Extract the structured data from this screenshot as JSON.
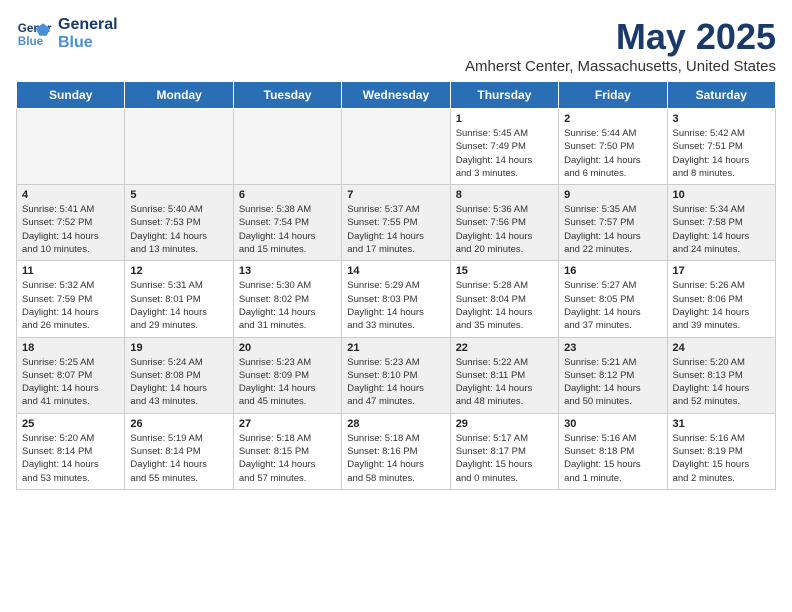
{
  "logo": {
    "line1": "General",
    "line2": "Blue"
  },
  "title": "May 2025",
  "subtitle": "Amherst Center, Massachusetts, United States",
  "headers": [
    "Sunday",
    "Monday",
    "Tuesday",
    "Wednesday",
    "Thursday",
    "Friday",
    "Saturday"
  ],
  "weeks": [
    [
      {
        "date": "",
        "text": "",
        "empty": true
      },
      {
        "date": "",
        "text": "",
        "empty": true
      },
      {
        "date": "",
        "text": "",
        "empty": true
      },
      {
        "date": "",
        "text": "",
        "empty": true
      },
      {
        "date": "1",
        "text": "Sunrise: 5:45 AM\nSunset: 7:49 PM\nDaylight: 14 hours\nand 3 minutes."
      },
      {
        "date": "2",
        "text": "Sunrise: 5:44 AM\nSunset: 7:50 PM\nDaylight: 14 hours\nand 6 minutes."
      },
      {
        "date": "3",
        "text": "Sunrise: 5:42 AM\nSunset: 7:51 PM\nDaylight: 14 hours\nand 8 minutes."
      }
    ],
    [
      {
        "date": "4",
        "text": "Sunrise: 5:41 AM\nSunset: 7:52 PM\nDaylight: 14 hours\nand 10 minutes.",
        "shaded": true
      },
      {
        "date": "5",
        "text": "Sunrise: 5:40 AM\nSunset: 7:53 PM\nDaylight: 14 hours\nand 13 minutes.",
        "shaded": true
      },
      {
        "date": "6",
        "text": "Sunrise: 5:38 AM\nSunset: 7:54 PM\nDaylight: 14 hours\nand 15 minutes.",
        "shaded": true
      },
      {
        "date": "7",
        "text": "Sunrise: 5:37 AM\nSunset: 7:55 PM\nDaylight: 14 hours\nand 17 minutes.",
        "shaded": true
      },
      {
        "date": "8",
        "text": "Sunrise: 5:36 AM\nSunset: 7:56 PM\nDaylight: 14 hours\nand 20 minutes.",
        "shaded": true
      },
      {
        "date": "9",
        "text": "Sunrise: 5:35 AM\nSunset: 7:57 PM\nDaylight: 14 hours\nand 22 minutes.",
        "shaded": true
      },
      {
        "date": "10",
        "text": "Sunrise: 5:34 AM\nSunset: 7:58 PM\nDaylight: 14 hours\nand 24 minutes.",
        "shaded": true
      }
    ],
    [
      {
        "date": "11",
        "text": "Sunrise: 5:32 AM\nSunset: 7:59 PM\nDaylight: 14 hours\nand 26 minutes."
      },
      {
        "date": "12",
        "text": "Sunrise: 5:31 AM\nSunset: 8:01 PM\nDaylight: 14 hours\nand 29 minutes."
      },
      {
        "date": "13",
        "text": "Sunrise: 5:30 AM\nSunset: 8:02 PM\nDaylight: 14 hours\nand 31 minutes."
      },
      {
        "date": "14",
        "text": "Sunrise: 5:29 AM\nSunset: 8:03 PM\nDaylight: 14 hours\nand 33 minutes."
      },
      {
        "date": "15",
        "text": "Sunrise: 5:28 AM\nSunset: 8:04 PM\nDaylight: 14 hours\nand 35 minutes."
      },
      {
        "date": "16",
        "text": "Sunrise: 5:27 AM\nSunset: 8:05 PM\nDaylight: 14 hours\nand 37 minutes."
      },
      {
        "date": "17",
        "text": "Sunrise: 5:26 AM\nSunset: 8:06 PM\nDaylight: 14 hours\nand 39 minutes."
      }
    ],
    [
      {
        "date": "18",
        "text": "Sunrise: 5:25 AM\nSunset: 8:07 PM\nDaylight: 14 hours\nand 41 minutes.",
        "shaded": true
      },
      {
        "date": "19",
        "text": "Sunrise: 5:24 AM\nSunset: 8:08 PM\nDaylight: 14 hours\nand 43 minutes.",
        "shaded": true
      },
      {
        "date": "20",
        "text": "Sunrise: 5:23 AM\nSunset: 8:09 PM\nDaylight: 14 hours\nand 45 minutes.",
        "shaded": true
      },
      {
        "date": "21",
        "text": "Sunrise: 5:23 AM\nSunset: 8:10 PM\nDaylight: 14 hours\nand 47 minutes.",
        "shaded": true
      },
      {
        "date": "22",
        "text": "Sunrise: 5:22 AM\nSunset: 8:11 PM\nDaylight: 14 hours\nand 48 minutes.",
        "shaded": true
      },
      {
        "date": "23",
        "text": "Sunrise: 5:21 AM\nSunset: 8:12 PM\nDaylight: 14 hours\nand 50 minutes.",
        "shaded": true
      },
      {
        "date": "24",
        "text": "Sunrise: 5:20 AM\nSunset: 8:13 PM\nDaylight: 14 hours\nand 52 minutes.",
        "shaded": true
      }
    ],
    [
      {
        "date": "25",
        "text": "Sunrise: 5:20 AM\nSunset: 8:14 PM\nDaylight: 14 hours\nand 53 minutes."
      },
      {
        "date": "26",
        "text": "Sunrise: 5:19 AM\nSunset: 8:14 PM\nDaylight: 14 hours\nand 55 minutes."
      },
      {
        "date": "27",
        "text": "Sunrise: 5:18 AM\nSunset: 8:15 PM\nDaylight: 14 hours\nand 57 minutes."
      },
      {
        "date": "28",
        "text": "Sunrise: 5:18 AM\nSunset: 8:16 PM\nDaylight: 14 hours\nand 58 minutes."
      },
      {
        "date": "29",
        "text": "Sunrise: 5:17 AM\nSunset: 8:17 PM\nDaylight: 15 hours\nand 0 minutes."
      },
      {
        "date": "30",
        "text": "Sunrise: 5:16 AM\nSunset: 8:18 PM\nDaylight: 15 hours\nand 1 minute."
      },
      {
        "date": "31",
        "text": "Sunrise: 5:16 AM\nSunset: 8:19 PM\nDaylight: 15 hours\nand 2 minutes."
      }
    ]
  ]
}
